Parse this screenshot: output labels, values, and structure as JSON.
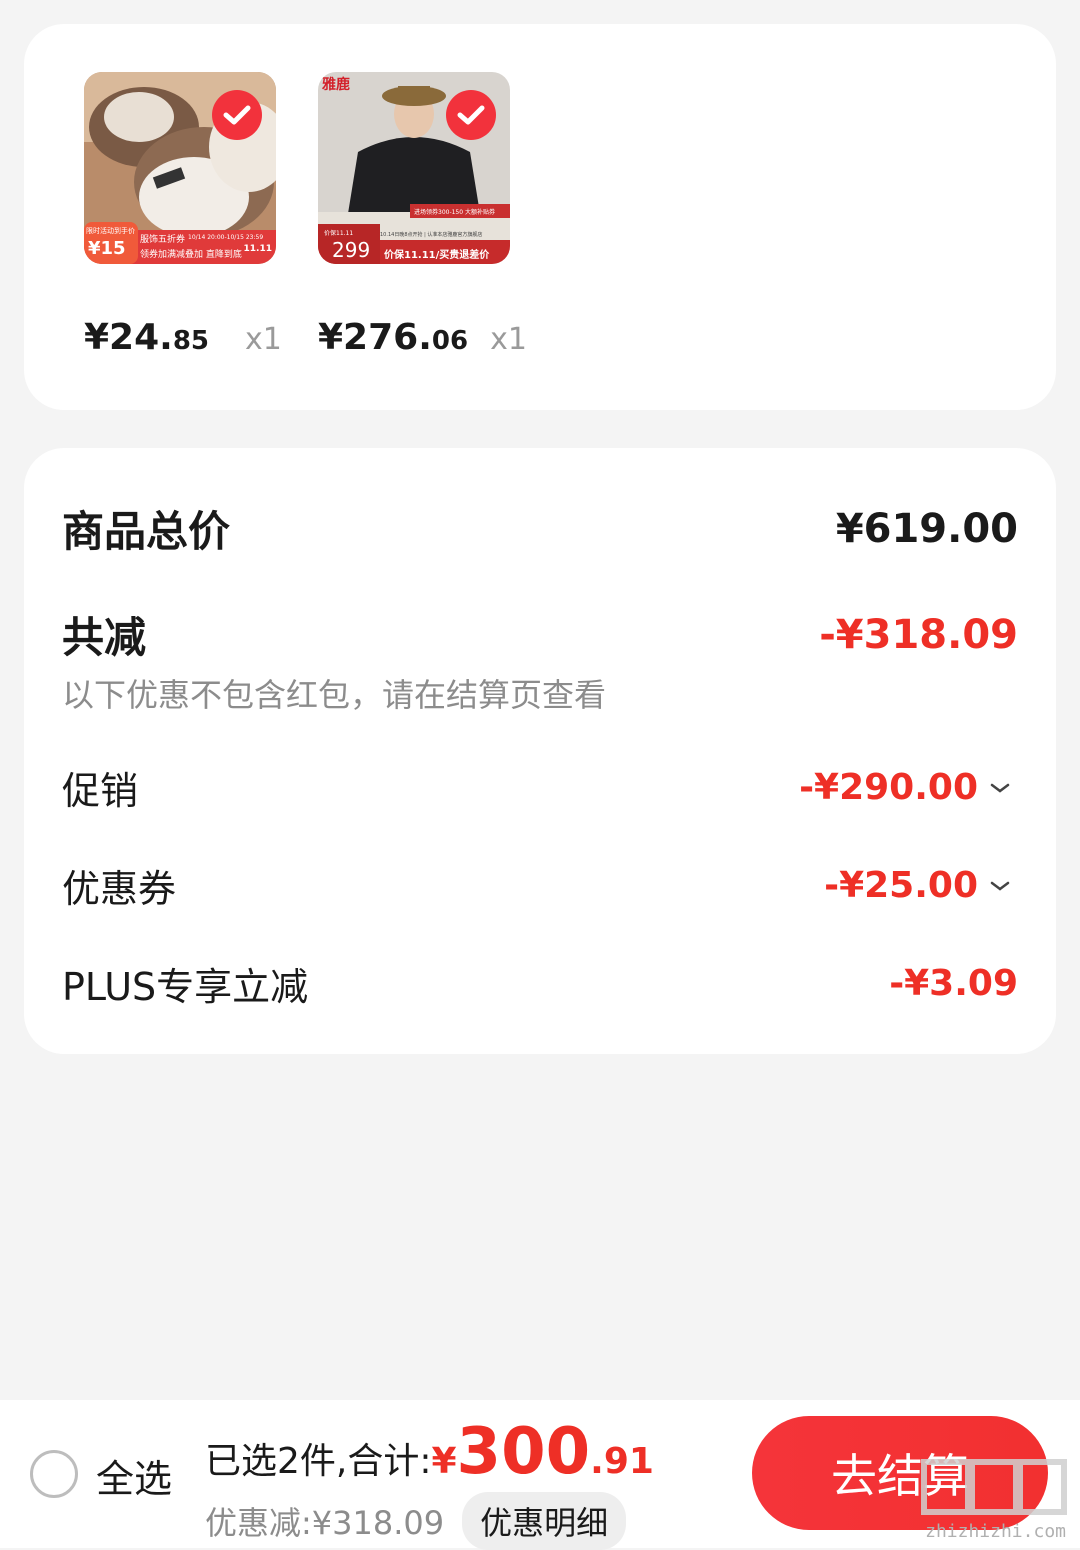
{
  "colors": {
    "accent_red": "#ee2f26",
    "button_red": "#f23030",
    "page_bg": "#f4f4f4"
  },
  "products": [
    {
      "price_int": "¥24.",
      "price_dec": "85",
      "qty": "x1",
      "badge_price": "¥15",
      "badge_text_1": "服饰五折券",
      "badge_text_2": "领券加满减叠加 直降到底",
      "badge_date": "10/14 20:00-10/15 23:59",
      "badge_tag": "限时活动到手价",
      "badge_1111": "11.11"
    },
    {
      "price_int": "¥276.",
      "price_dec": "06",
      "qty": "x1",
      "brand_logo": "雅鹿",
      "badge_price": "299",
      "badge_label": "价保11.11",
      "badge_text": "价保11.11/买贵退差价",
      "badge_date": "10.14日晚8点开抢 | 认准本店雅鹿官方旗舰店",
      "badge_promo": "进场领券300-150 大额补贴券"
    }
  ],
  "summary": {
    "total_label": "商品总价",
    "total_value": "¥619.00",
    "reduce_label": "共减",
    "reduce_value": "-¥318.09",
    "note": "以下优惠不包含红包，请在结算页查看",
    "items": [
      {
        "label": "促销",
        "value": "-¥290.00",
        "expandable": true
      },
      {
        "label": "优惠券",
        "value": "-¥25.00",
        "expandable": true
      },
      {
        "label": "PLUS专享立减",
        "value": "-¥3.09",
        "expandable": false
      }
    ]
  },
  "bottom_bar": {
    "select_all": "全选",
    "selected_label": "已选2件,合计:",
    "yen": "¥",
    "total_int": "300",
    "total_dec": ".91",
    "discount_text": "优惠减:¥318.09",
    "detail_button": "优惠明细",
    "checkout_button": "去结算"
  },
  "watermark": {
    "text": "zhizhizhi.com",
    "logo": "值值值"
  }
}
